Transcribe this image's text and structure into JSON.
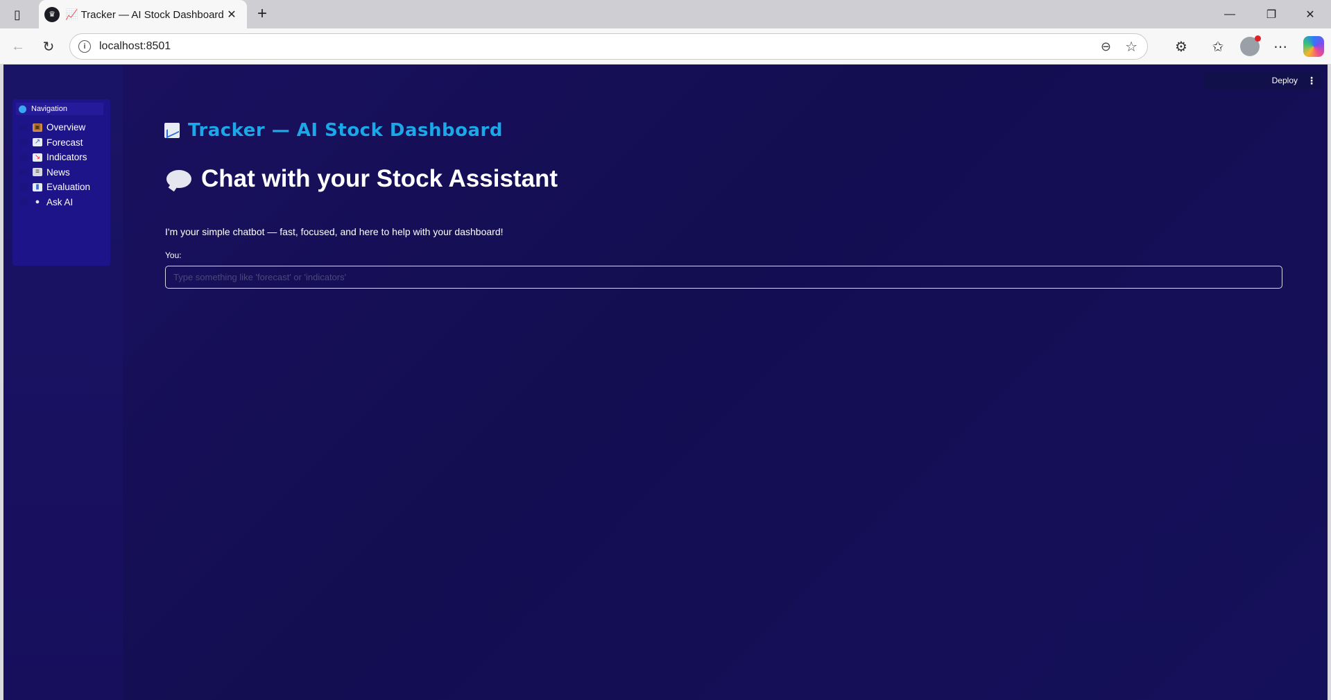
{
  "browser": {
    "tab_title": "📈 Tracker — AI Stock Dashboard",
    "url": "localhost:8501"
  },
  "sidebar": {
    "header": "Navigation",
    "items": [
      {
        "label": "Overview",
        "icon": "package-icon"
      },
      {
        "label": "Forecast",
        "icon": "chart-up-icon"
      },
      {
        "label": "Indicators",
        "icon": "chart-down-icon"
      },
      {
        "label": "News",
        "icon": "newspaper-icon"
      },
      {
        "label": "Evaluation",
        "icon": "bar-chart-icon"
      },
      {
        "label": "Ask AI",
        "icon": "speech-bubble-icon"
      }
    ]
  },
  "toolbar": {
    "deploy_label": "Deploy"
  },
  "main": {
    "app_title": "Tracker — AI Stock Dashboard",
    "chat_heading": "Chat with your Stock Assistant",
    "intro": "I'm your simple chatbot — fast, focused, and here to help with your dashboard!",
    "input_label": "You:",
    "input_placeholder": "Type something like 'forecast' or 'indicators'",
    "input_value": ""
  },
  "colors": {
    "background": "#150f58",
    "title_accent": "#1aa8e8",
    "sidebar_panel": "#1d148a"
  }
}
